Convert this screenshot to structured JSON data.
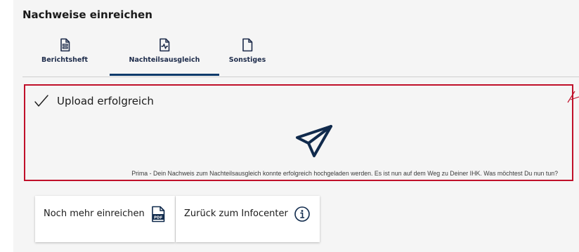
{
  "page": {
    "title": "Nachweise einreichen"
  },
  "tabs": [
    {
      "label": "Berichtsheft",
      "icon": "document-list-icon",
      "active": false
    },
    {
      "label": "Nachteilsausgleich",
      "icon": "heart-pulse-icon",
      "active": true
    },
    {
      "label": "Sonstiges",
      "icon": "file-icon",
      "active": false
    }
  ],
  "success": {
    "title": "Upload erfolgreich",
    "message": "Prima - Dein Nachweis zum Nachteilsausgleich konnte erfolgreich hochgeladen werden. Es ist nun auf dem Weg zu Deiner IHK. Was möchtest Du nun tun?",
    "icons": {
      "status": "check-icon",
      "illustration": "paper-plane-icon"
    }
  },
  "actions": [
    {
      "label": "Noch mehr einreichen",
      "icon": "pdf-icon"
    },
    {
      "label": "Zurück zum Infocenter",
      "icon": "info-circle-icon"
    }
  ],
  "colors": {
    "accent": "#0b3a6b",
    "highlight_border": "#c0102a",
    "panel_bg": "#f5f5f5"
  }
}
